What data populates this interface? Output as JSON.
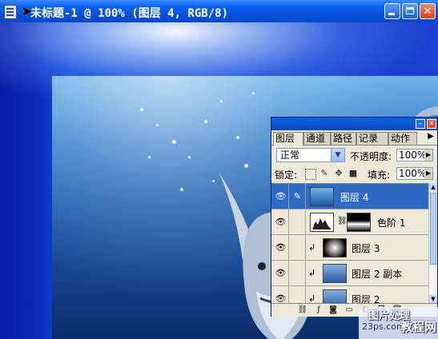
{
  "window": {
    "title": "未标题-1 @ 100% (图层 4, RGB/8)"
  },
  "layers_panel": {
    "tabs": [
      {
        "label": "图层",
        "active": true
      },
      {
        "label": "通道",
        "active": false
      },
      {
        "label": "路径",
        "active": false
      },
      {
        "label": "记录",
        "active": false
      },
      {
        "label": "动作",
        "active": false
      }
    ],
    "blend_mode": "正常",
    "opacity_label": "不透明度:",
    "opacity_value": "100%",
    "lock_label": "锁定:",
    "fill_label": "填充:",
    "fill_value": "100%",
    "layers": [
      {
        "name": "图层 4",
        "selected": true,
        "visible": true
      },
      {
        "name": "色阶 1",
        "selected": false,
        "visible": true
      },
      {
        "name": "图层 3",
        "selected": false,
        "visible": true
      },
      {
        "name": "图层 2 副本",
        "selected": false,
        "visible": true
      },
      {
        "name": "图层 2",
        "selected": false,
        "visible": true
      }
    ]
  },
  "watermark": {
    "line1": "图片处理",
    "line2": "23ps.com",
    "line3": "教程网"
  },
  "colors": {
    "titlebar": "#0a5ff0",
    "selection": "#316ac5",
    "panel_bg": "#ece9d8"
  }
}
